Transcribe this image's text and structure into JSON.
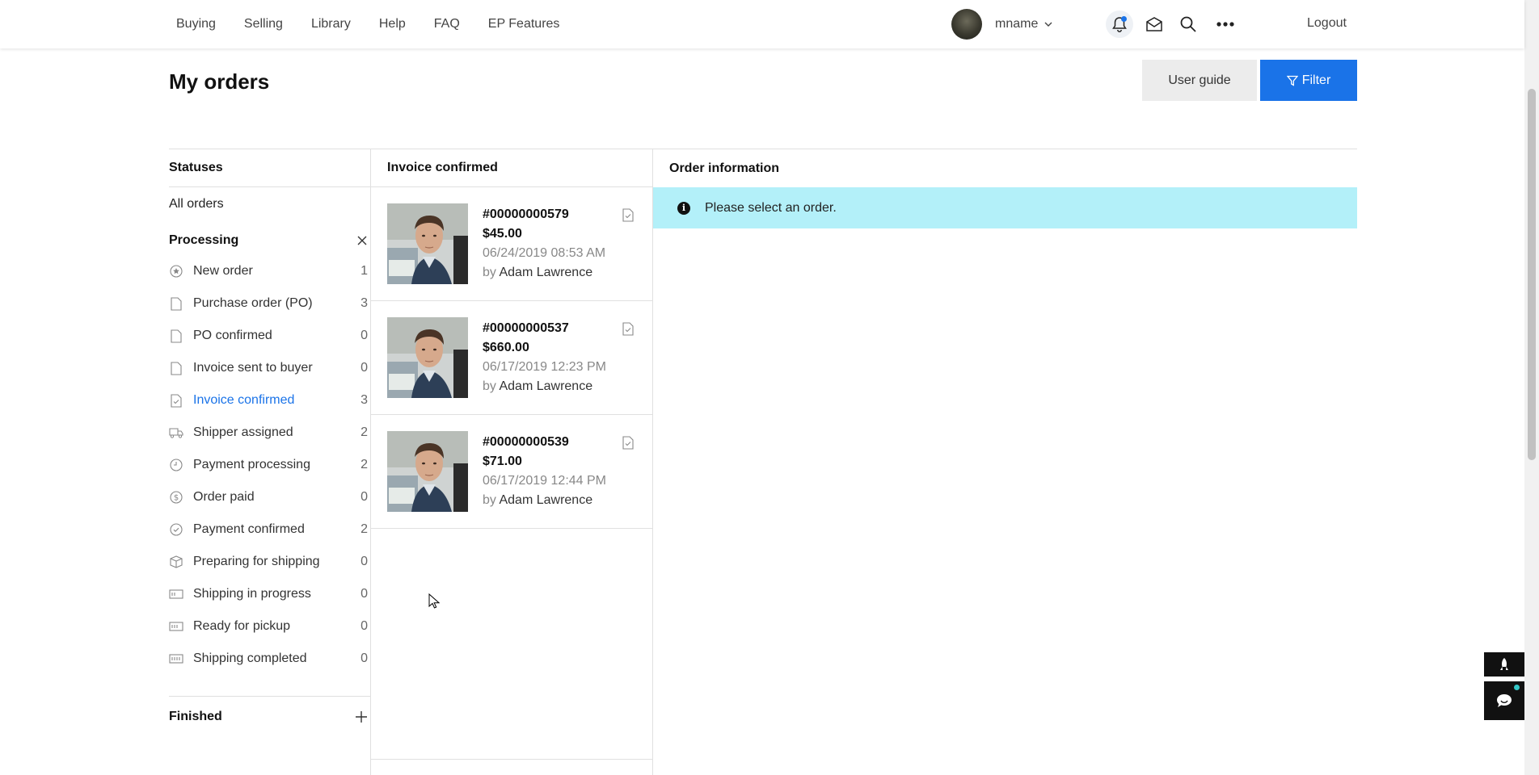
{
  "nav": {
    "items": [
      "Buying",
      "Selling",
      "Library",
      "Help",
      "FAQ",
      "EP Features"
    ],
    "username": "mname",
    "logout": "Logout",
    "icons": [
      "bell-icon",
      "envelope-icon",
      "search-icon",
      "more-icon"
    ]
  },
  "header": {
    "title": "My orders",
    "user_guide": "User guide",
    "filter": "Filter"
  },
  "statuses": {
    "heading": "Statuses",
    "all_orders": "All orders",
    "processing": "Processing",
    "finished": "Finished",
    "items": [
      {
        "label": "New order",
        "count": "1",
        "icon": "star-circle-icon"
      },
      {
        "label": "Purchase order (PO)",
        "count": "3",
        "icon": "document-icon"
      },
      {
        "label": "PO confirmed",
        "count": "0",
        "icon": "document-icon"
      },
      {
        "label": "Invoice sent to buyer",
        "count": "0",
        "icon": "document-icon"
      },
      {
        "label": "Invoice confirmed",
        "count": "3",
        "icon": "document-check-icon",
        "active": true
      },
      {
        "label": "Shipper assigned",
        "count": "2",
        "icon": "truck-icon"
      },
      {
        "label": "Payment processing",
        "count": "2",
        "icon": "clock-icon"
      },
      {
        "label": "Order paid",
        "count": "0",
        "icon": "dollar-circle-icon"
      },
      {
        "label": "Payment confirmed",
        "count": "2",
        "icon": "check-circle-icon"
      },
      {
        "label": "Preparing for shipping",
        "count": "0",
        "icon": "box-icon"
      },
      {
        "label": "Shipping in progress",
        "count": "0",
        "icon": "shipping-icon"
      },
      {
        "label": "Ready for pickup",
        "count": "0",
        "icon": "pickup-icon"
      },
      {
        "label": "Shipping completed",
        "count": "0",
        "icon": "shipping-done-icon"
      }
    ]
  },
  "orders": {
    "heading": "Invoice confirmed",
    "list": [
      {
        "id": "#00000000579",
        "price": "$45.00",
        "date": "06/24/2019 08:53 AM",
        "by": "by",
        "buyer": "Adam Lawrence"
      },
      {
        "id": "#00000000537",
        "price": "$660.00",
        "date": "06/17/2019 12:23 PM",
        "by": "by",
        "buyer": "Adam Lawrence"
      },
      {
        "id": "#00000000539",
        "price": "$71.00",
        "date": "06/17/2019 12:44 PM",
        "by": "by",
        "buyer": "Adam Lawrence"
      }
    ]
  },
  "info": {
    "heading": "Order information",
    "alert": "Please select an order."
  },
  "colors": {
    "accent": "#1a73e8",
    "alert_bg": "#b3f0f9"
  }
}
